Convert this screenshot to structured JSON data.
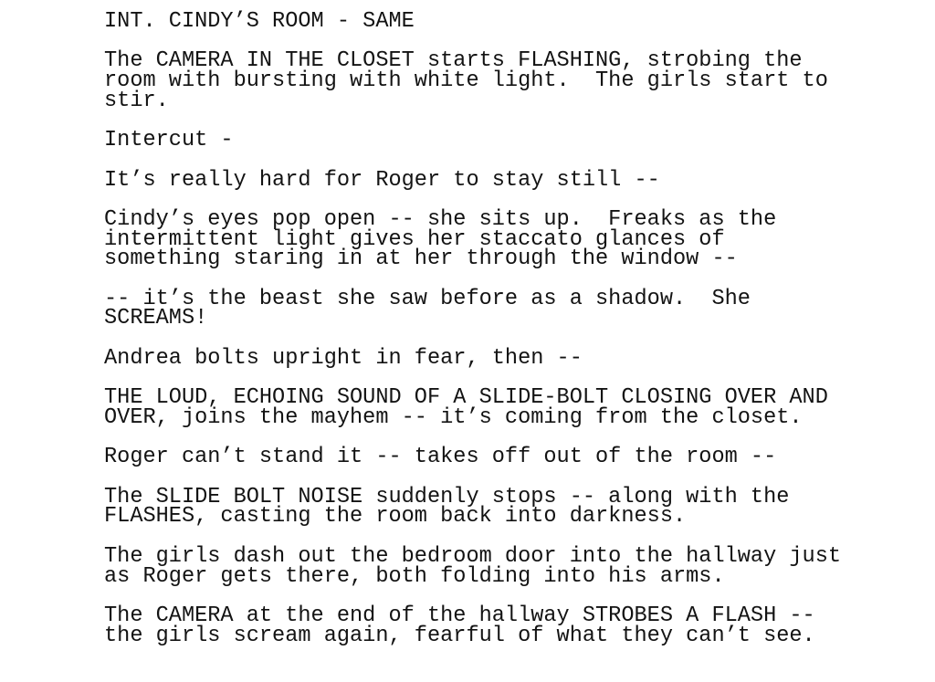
{
  "document": {
    "type": "screenplay-page",
    "background_color": "#ffffff",
    "text_color": "#131313",
    "blocks": [
      {
        "name": "scene-heading",
        "kind": "scene-heading",
        "text": "INT. CINDY’S ROOM - SAME"
      },
      {
        "name": "action-camera-flashing",
        "kind": "action",
        "text": "The CAMERA IN THE CLOSET starts FLASHING, strobing the\nroom with bursting with white light.  The girls start to\nstir."
      },
      {
        "name": "action-intercut",
        "kind": "action",
        "text": "Intercut -"
      },
      {
        "name": "action-roger-stay-still",
        "kind": "action",
        "text": "It’s really hard for Roger to stay still --"
      },
      {
        "name": "action-cindy-eyes-pop-open",
        "kind": "action",
        "text": "Cindy’s eyes pop open -- she sits up.  Freaks as the\nintermittent light gives her staccato glances of\nsomething staring in at her through the window --"
      },
      {
        "name": "action-beast-shadow-screams",
        "kind": "action",
        "text": "-- it’s the beast she saw before as a shadow.  She\nSCREAMS!"
      },
      {
        "name": "action-andrea-bolts-upright",
        "kind": "action",
        "text": "Andrea bolts upright in fear, then --"
      },
      {
        "name": "action-slide-bolt-sound",
        "kind": "action",
        "text": "THE LOUD, ECHOING SOUND OF A SLIDE-BOLT CLOSING OVER AND\nOVER, joins the mayhem -- it’s coming from the closet."
      },
      {
        "name": "action-roger-takes-off",
        "kind": "action",
        "text": "Roger can’t stand it -- takes off out of the room --"
      },
      {
        "name": "action-noise-stops-darkness",
        "kind": "action",
        "text": "The SLIDE BOLT NOISE suddenly stops -- along with the\nFLASHES, casting the room back into darkness."
      },
      {
        "name": "action-girls-dash-hallway",
        "kind": "action",
        "text": "The girls dash out the bedroom door into the hallway just\nas Roger gets there, both folding into his arms."
      },
      {
        "name": "action-camera-strobes-flash",
        "kind": "action",
        "text": "The CAMERA at the end of the hallway STROBES A FLASH --\nthe girls scream again, fearful of what they can’t see."
      }
    ]
  }
}
